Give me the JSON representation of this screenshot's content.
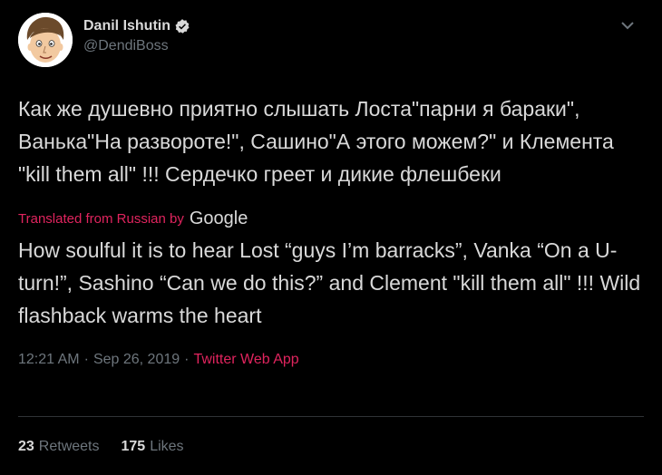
{
  "author": {
    "display_name": "Danil Ishutin",
    "handle": "@DendiBoss",
    "verified_icon": "verified-badge-icon"
  },
  "tweet": {
    "original_text": "Как же душевно приятно слышать Лоста\"парни я бараки\", Ванька\"На развороте!\", Сашино\"А этого можем?\" и Клемента \"kill them all\" !!! Сердечко греет и дикие флешбеки",
    "translated_label": "Translated from Russian by",
    "translator": "Google",
    "translated_text": "How soulful it is to hear Lost “guys I’m barracks”, Vanka “On a U-turn!”, Sashino “Can we do this?” and Clement \"kill them all\" !!! Wild flashback warms the heart",
    "time": "12:21 AM",
    "date": "Sep 26, 2019",
    "separator": "·",
    "source_app": "Twitter Web App"
  },
  "stats": {
    "retweets_count": "23",
    "retweets_label": "Retweets",
    "likes_count": "175",
    "likes_label": "Likes"
  },
  "colors": {
    "background": "#000000",
    "text": "#d9d9d9",
    "muted": "#6e767d",
    "accent": "#e0245e",
    "divider": "#2f3336"
  }
}
